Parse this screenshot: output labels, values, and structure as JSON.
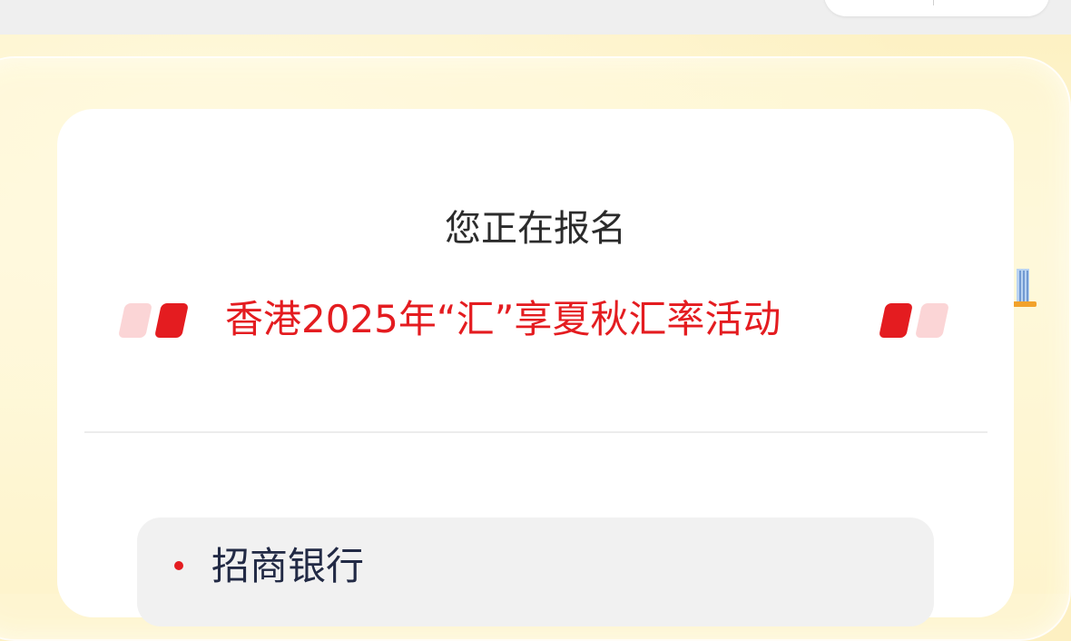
{
  "signup": {
    "subtitle": "您正在报名",
    "event_title": "香港2025年“汇”享夏秋汇率活动"
  },
  "bank": {
    "name": "招商银行"
  },
  "colors": {
    "accent_red": "#e41c20",
    "accent_pink": "#fbd5d6",
    "banner_yellow": "#fdf0c2",
    "card_white": "#ffffff",
    "bank_box_gray": "#f1f1f1",
    "bank_text": "#222a45"
  }
}
